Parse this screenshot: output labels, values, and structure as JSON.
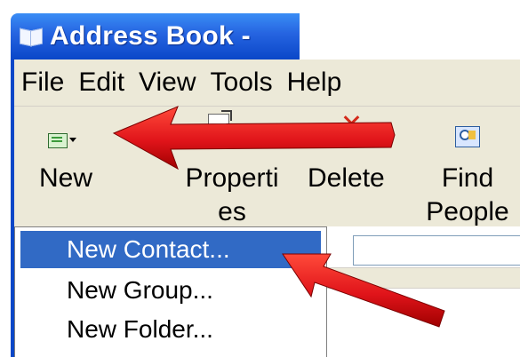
{
  "window": {
    "title": "Address Book -"
  },
  "menu": {
    "file": "File",
    "edit": "Edit",
    "view": "View",
    "tools": "Tools",
    "help": "Help"
  },
  "toolbar": {
    "new_label": "New",
    "properties_line1": "Properti",
    "properties_line2": "es",
    "delete_label": "Delete",
    "find_line1": "Find",
    "find_line2": "People"
  },
  "new_menu": {
    "items": [
      {
        "label": "New Contact...",
        "selected": true
      },
      {
        "label": "New Group...",
        "selected": false
      },
      {
        "label": "New Folder...",
        "selected": false
      }
    ]
  },
  "icons": {
    "app": "address-book-icon",
    "new": "new-contact-card-icon",
    "properties": "properties-icon",
    "delete": "delete-x-icon",
    "find": "find-people-icon"
  },
  "colors": {
    "titlebar_blue": "#2563e0",
    "selection_blue": "#316ac5",
    "annotation_red": "#e0141a",
    "toolbar_bg": "#ece9d8"
  }
}
